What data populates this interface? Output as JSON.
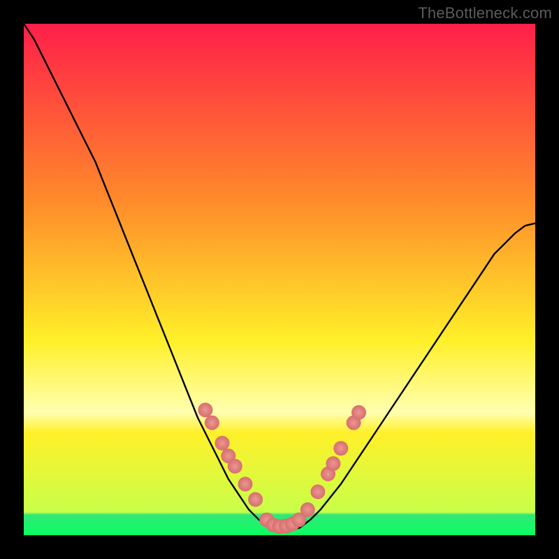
{
  "attribution": "TheBottleneck.com",
  "colors": {
    "top_red": "#ff1f49",
    "mid_orange": "#ff8c2a",
    "yellow": "#fff029",
    "pale_yellow": "#ffffb0",
    "green_band": "#32e878",
    "bright_green": "#08ff5f",
    "marker_fill": "#e07f7f",
    "marker_glow": "#e89a90",
    "curve": "#000000"
  },
  "chart_data": {
    "type": "line",
    "title": "",
    "xlabel": "",
    "ylabel": "",
    "xlim": [
      0,
      100
    ],
    "ylim": [
      0,
      100
    ],
    "series": [
      {
        "name": "bottleneck-curve",
        "x": [
          0,
          2,
          4,
          6,
          8,
          10,
          12,
          14,
          16,
          18,
          20,
          22,
          24,
          26,
          28,
          30,
          32,
          34,
          36,
          38,
          40,
          42,
          44,
          46,
          48,
          50,
          52,
          54,
          56,
          58,
          60,
          62,
          64,
          66,
          68,
          70,
          72,
          74,
          76,
          78,
          80,
          82,
          84,
          86,
          88,
          90,
          92,
          94,
          96,
          98,
          100
        ],
        "y": [
          100,
          97,
          93,
          89,
          85,
          81,
          77,
          73,
          68,
          63,
          58,
          53,
          48,
          43,
          38,
          33,
          28,
          23,
          19,
          15,
          11,
          8,
          5,
          3,
          1.5,
          0.8,
          0.8,
          1.5,
          3,
          5,
          7.5,
          10,
          13,
          16,
          19,
          22,
          25,
          28,
          31,
          34,
          37,
          40,
          43,
          46,
          49,
          52,
          55,
          57,
          59,
          60.5,
          61
        ]
      }
    ],
    "markers": {
      "name": "sample-points",
      "points": [
        {
          "x": 35.5,
          "y": 24.5
        },
        {
          "x": 36.8,
          "y": 22.0
        },
        {
          "x": 38.8,
          "y": 18.0
        },
        {
          "x": 40.0,
          "y": 15.5
        },
        {
          "x": 41.3,
          "y": 13.5
        },
        {
          "x": 43.3,
          "y": 10.0
        },
        {
          "x": 45.3,
          "y": 7.0
        },
        {
          "x": 47.5,
          "y": 3.0
        },
        {
          "x": 48.8,
          "y": 2.0
        },
        {
          "x": 50.0,
          "y": 1.7
        },
        {
          "x": 51.3,
          "y": 1.8
        },
        {
          "x": 52.5,
          "y": 2.2
        },
        {
          "x": 53.8,
          "y": 3.0
        },
        {
          "x": 55.5,
          "y": 5.0
        },
        {
          "x": 57.5,
          "y": 8.5
        },
        {
          "x": 59.5,
          "y": 12.0
        },
        {
          "x": 60.5,
          "y": 14.0
        },
        {
          "x": 62.0,
          "y": 17.0
        },
        {
          "x": 64.5,
          "y": 22.0
        },
        {
          "x": 65.5,
          "y": 24.0
        }
      ]
    },
    "bands": [
      {
        "name": "pale-yellow-band",
        "y0": 20,
        "y1": 24
      },
      {
        "name": "green-band",
        "y0": 0,
        "y1": 4
      }
    ]
  }
}
